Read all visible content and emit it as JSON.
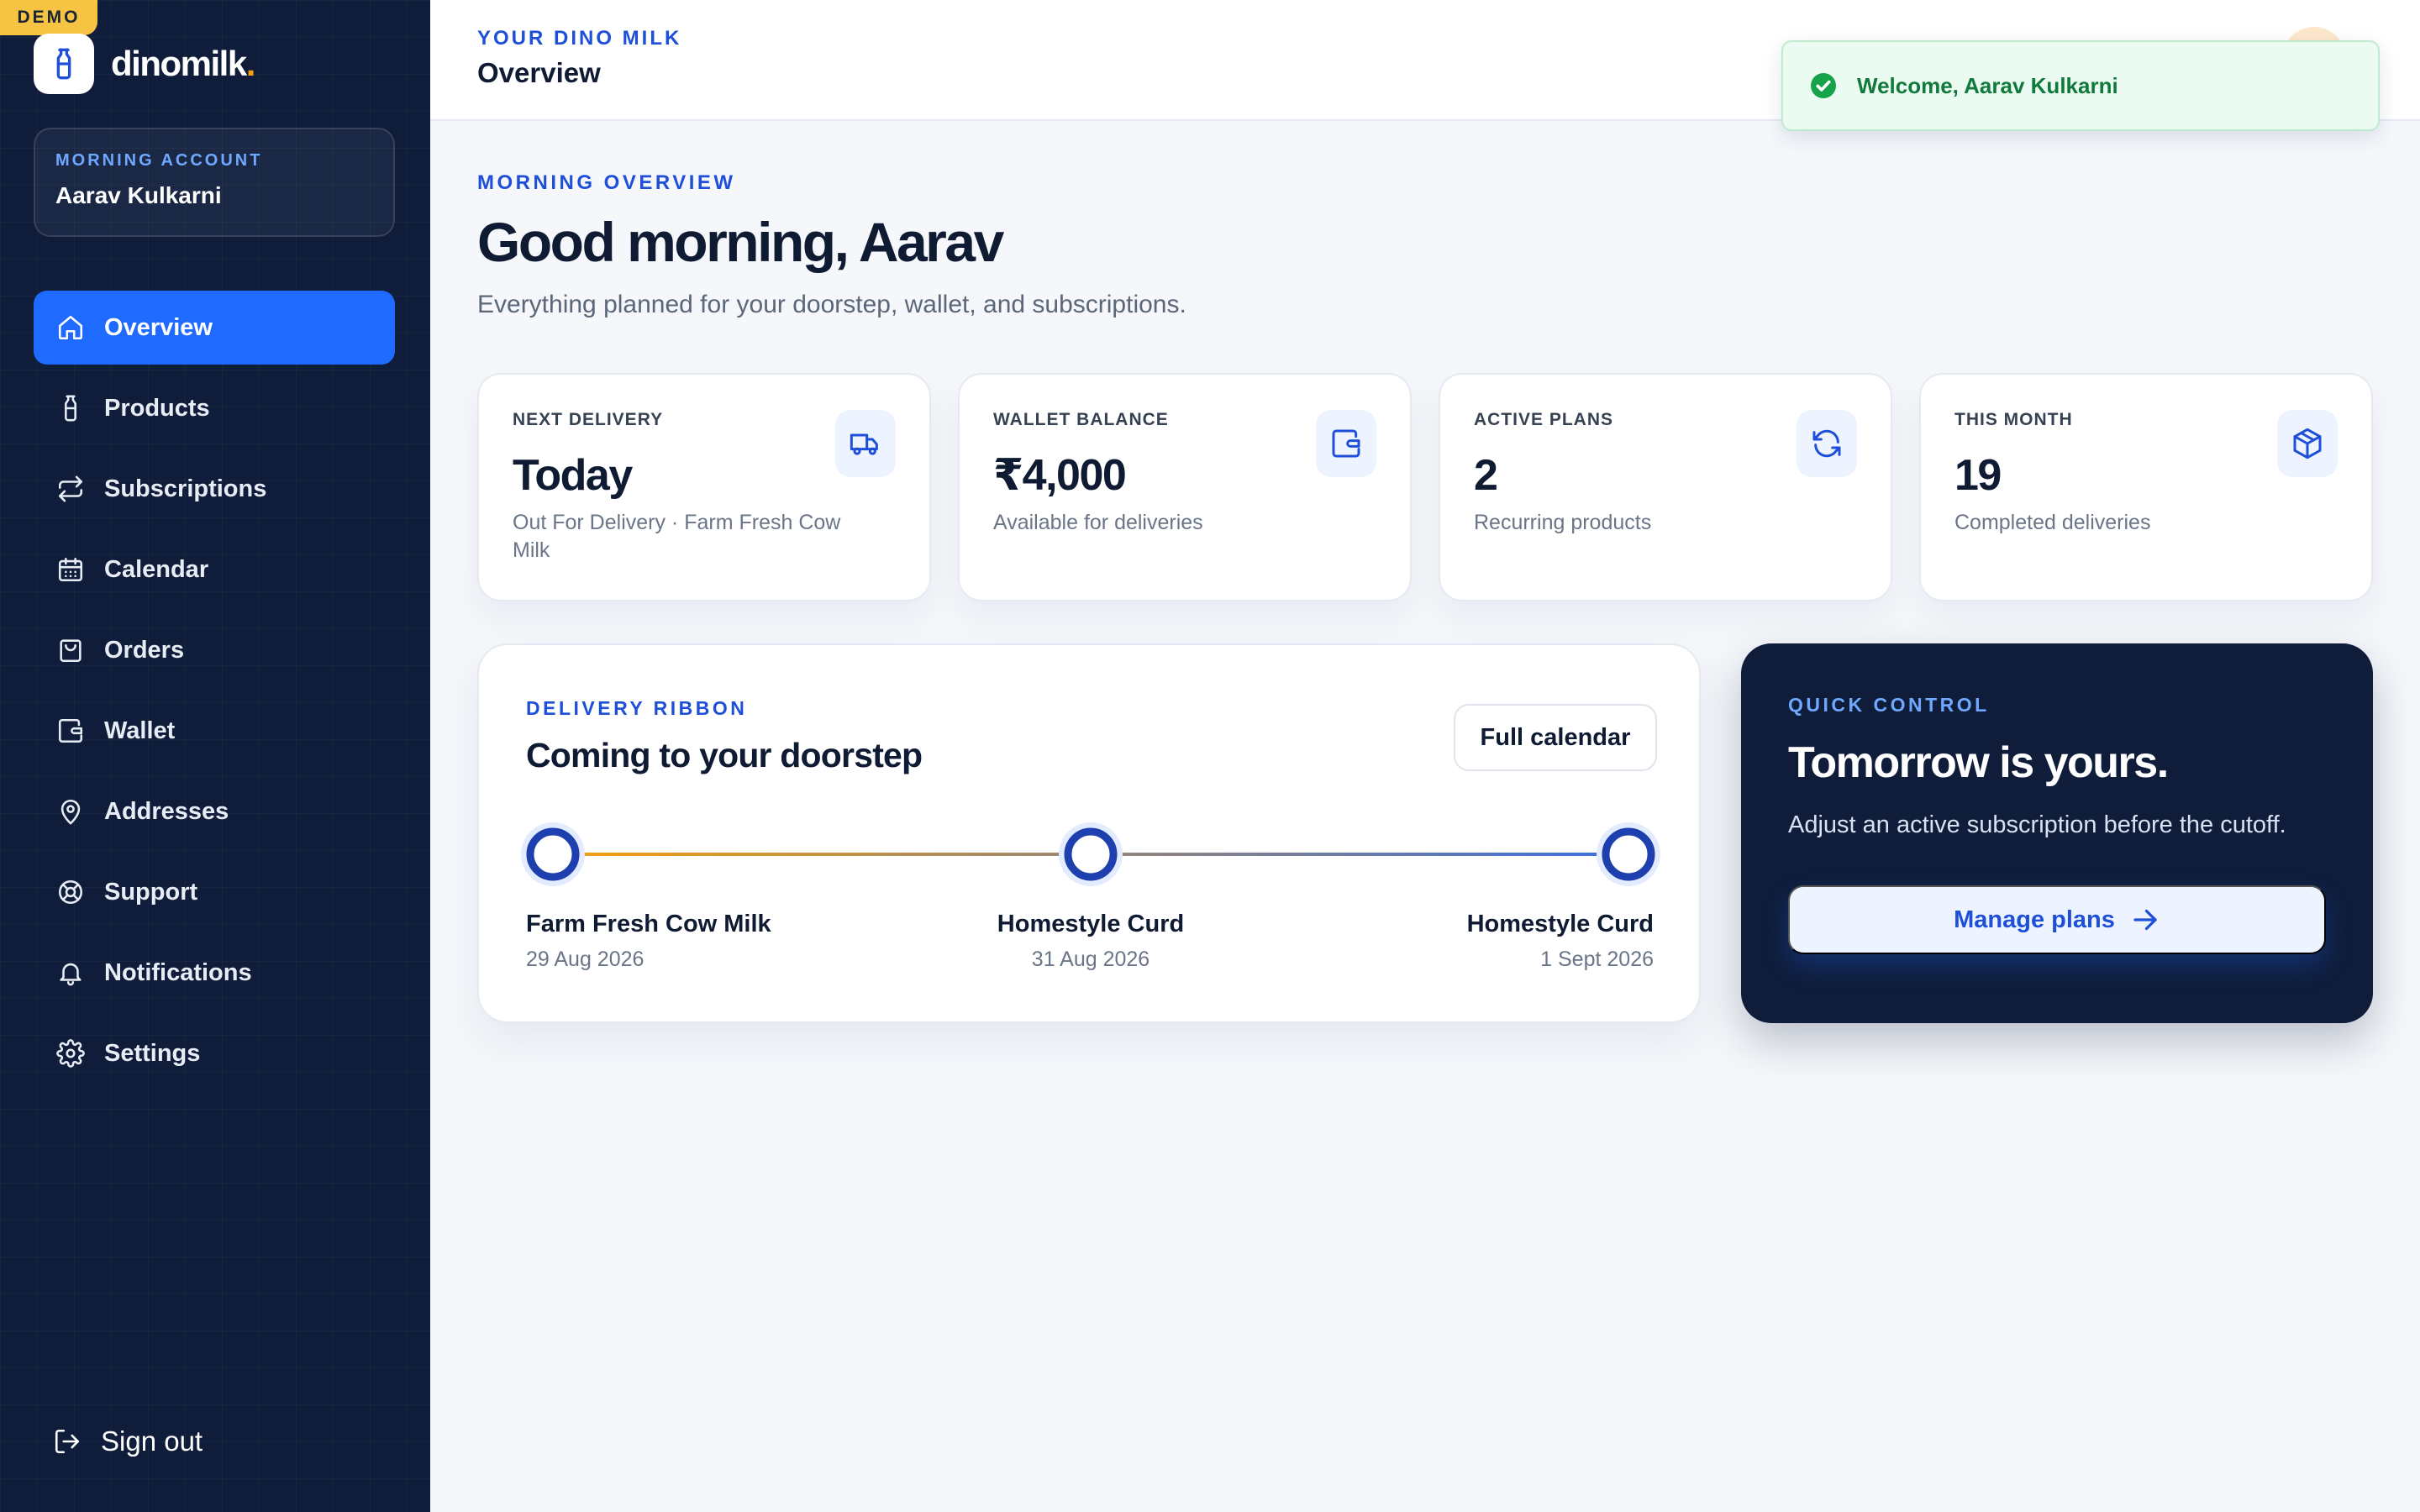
{
  "brand": {
    "badge": "DEMO",
    "name": "dinomilk",
    "dot": "."
  },
  "account": {
    "kicker": "MORNING ACCOUNT",
    "name": "Aarav Kulkarni"
  },
  "nav": {
    "items": [
      {
        "label": "Overview",
        "icon": "home-icon",
        "active": true
      },
      {
        "label": "Products",
        "icon": "bottle-icon"
      },
      {
        "label": "Subscriptions",
        "icon": "repeat-icon"
      },
      {
        "label": "Calendar",
        "icon": "calendar-icon"
      },
      {
        "label": "Orders",
        "icon": "shopping-bag-icon"
      },
      {
        "label": "Wallet",
        "icon": "wallet-icon"
      },
      {
        "label": "Addresses",
        "icon": "map-pin-icon"
      },
      {
        "label": "Support",
        "icon": "lifebuoy-icon"
      },
      {
        "label": "Notifications",
        "icon": "bell-icon"
      },
      {
        "label": "Settings",
        "icon": "gear-icon"
      }
    ],
    "signout": "Sign out"
  },
  "header": {
    "kicker": "YOUR DINO MILK",
    "title": "Overview"
  },
  "toast": {
    "text": "Welcome, Aarav Kulkarni"
  },
  "hero": {
    "kicker": "MORNING OVERVIEW",
    "title": "Good morning, Aarav",
    "subtitle": "Everything planned for your doorstep, wallet, and subscriptions."
  },
  "stats": [
    {
      "label": "NEXT DELIVERY",
      "value": "Today",
      "sub": "Out For Delivery · Farm Fresh Cow Milk",
      "icon": "truck-icon"
    },
    {
      "label": "WALLET BALANCE",
      "value": "₹4,000",
      "sub": "Available for deliveries",
      "icon": "wallet-icon"
    },
    {
      "label": "ACTIVE PLANS",
      "value": "2",
      "sub": "Recurring products",
      "icon": "refresh-icon"
    },
    {
      "label": "THIS MONTH",
      "value": "19",
      "sub": "Completed deliveries",
      "icon": "package-icon"
    }
  ],
  "ribbon": {
    "kicker": "DELIVERY RIBBON",
    "title": "Coming to your doorstep",
    "button": "Full calendar",
    "stops": [
      {
        "name": "Farm Fresh Cow Milk",
        "date": "29 Aug 2026"
      },
      {
        "name": "Homestyle Curd",
        "date": "31 Aug 2026"
      },
      {
        "name": "Homestyle Curd",
        "date": "1 Sept 2026"
      }
    ]
  },
  "quick": {
    "kicker": "QUICK CONTROL",
    "title": "Tomorrow is yours.",
    "subtitle": "Adjust an active subscription before the cutoff.",
    "button": "Manage plans"
  },
  "colors": {
    "sidebar": "#0f1d3b",
    "accent": "#1f6bff",
    "kicker": "#1e4fd8",
    "success": "#0f7a3c",
    "badge": "#f6c343",
    "timeline_start": "#f59e0b",
    "timeline_end": "#3b6fe0"
  }
}
